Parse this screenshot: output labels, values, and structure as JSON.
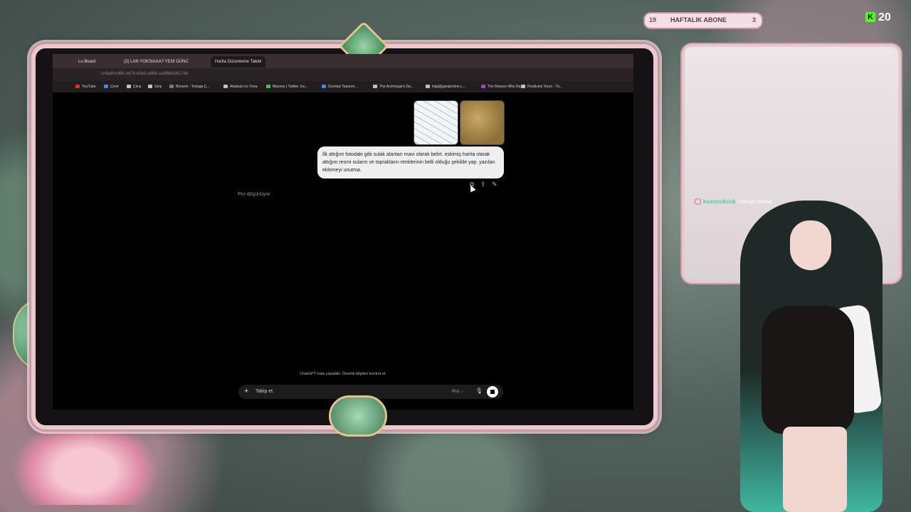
{
  "browser": {
    "tabs": [
      {
        "label": "Lu Board"
      },
      {
        "label": "(3) LAN YOKSIAAA? YENİ GÜNC"
      },
      {
        "label": "Harita Düzenleme Talebi"
      }
    ],
    "url": "/c/6a80cd86-dd78-83e0-a668-a2df8b5db17de",
    "bookmarks": [
      {
        "label": "YouTube",
        "color": "#e3322f"
      },
      {
        "label": "Çevir",
        "color": "#4a86e8"
      },
      {
        "label": "Çıkış",
        "color": "#c0c0c0"
      },
      {
        "label": "Giriş",
        "color": "#c0c0c0"
      },
      {
        "label": "Berserk - Tortuga Ç...",
        "color": "#777777"
      },
      {
        "label": "Akatsuki no Yona",
        "color": "#c0c0c0"
      },
      {
        "label": "Maxnes | Twitter. Ins...",
        "color": "#3fbf5a"
      },
      {
        "label": "Ücretsiz Tasarım...",
        "color": "#4a86e8"
      },
      {
        "label": "The Archmage's Da...",
        "color": "#c0c0c0"
      },
      {
        "label": "bilgi@garajonline.c...",
        "color": "#c0c0c0"
      },
      {
        "label": "The Reason Why Ra...",
        "color": "#8a4fbf"
      },
      {
        "label": "Positively Yours - Tü...",
        "color": "#c0c0c0"
      }
    ]
  },
  "chatgpt": {
    "user_message": "İlk attığım fotodaki gibi sulak alanları mavi olarak belirt. eskimiş harita olarak attığım resmi suların ve toprakların renklerinin belli olduğu şekilde yap. yazıları eklemeyi unutma.",
    "status": "Pro düşünüyor",
    "disclaimer": "ChatGPT hata yapabilir. Önemli bilgileri kontrol et.",
    "composer_placeholder": "Takip et",
    "model": "Pro ⌵"
  },
  "stream": {
    "subs_left": "19",
    "subs_title": "HAFTALIK ABONE",
    "subs_right": "3",
    "kick_count": "20",
    "kick_letter": "K",
    "chat_user": "kuzucukcuk",
    "chat_text": ": noluyo burda"
  }
}
